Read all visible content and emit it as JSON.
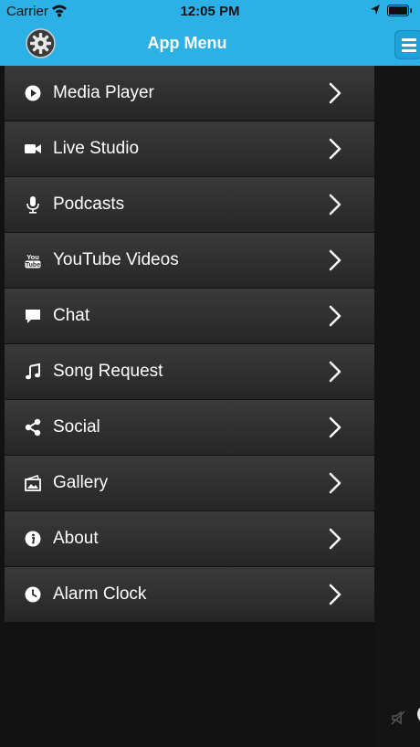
{
  "status_bar": {
    "carrier": "Carrier",
    "time": "12:05 PM"
  },
  "drawer": {
    "title": "App Menu",
    "items": [
      {
        "label": "Media Player",
        "icon": "play-circle-icon"
      },
      {
        "label": "Live Studio",
        "icon": "video-camera-icon"
      },
      {
        "label": "Podcasts",
        "icon": "microphone-icon"
      },
      {
        "label": "YouTube Videos",
        "icon": "youtube-icon"
      },
      {
        "label": "Chat",
        "icon": "chat-bubble-icon"
      },
      {
        "label": "Song Request",
        "icon": "music-note-icon"
      },
      {
        "label": "Social",
        "icon": "share-icon"
      },
      {
        "label": "Gallery",
        "icon": "gallery-icon"
      },
      {
        "label": "About",
        "icon": "info-icon"
      },
      {
        "label": "Alarm Clock",
        "icon": "clock-icon"
      }
    ]
  },
  "colors": {
    "header_blue": "#2bb1e6",
    "menu_item_top": "#3a3a3a",
    "menu_item_bottom": "#262626",
    "background": "#121212"
  }
}
